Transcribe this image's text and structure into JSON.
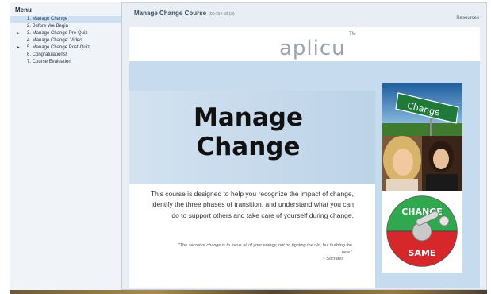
{
  "sidebar": {
    "title": "Menu",
    "items": [
      {
        "label": "1. Manage Change",
        "active": true,
        "expandable": false
      },
      {
        "label": "2. Before We Begin",
        "active": false,
        "expandable": false
      },
      {
        "label": "3. Manage Change Pre-Quiz",
        "active": false,
        "expandable": true
      },
      {
        "label": "4. Manage Change: Video",
        "active": false,
        "expandable": false
      },
      {
        "label": "5. Manage Change Post-Quiz",
        "active": false,
        "expandable": true
      },
      {
        "label": "6. Congratulations!",
        "active": false,
        "expandable": false
      },
      {
        "label": "7. Course Evaluation",
        "active": false,
        "expandable": false
      }
    ]
  },
  "header": {
    "course_title": "Manage Change Course",
    "time": "(00:19 / 18:18)",
    "resources_label": "Resources"
  },
  "slide": {
    "logo": "aplicu",
    "tm": "TM",
    "title_line1": "Manage",
    "title_line2": "Change",
    "description": "This course is designed to help you recognize the impact of change, identify the three phases of transition, and understand what you can do to support others and take care of yourself during change.",
    "quote": "\"The secret of change is to focus all of your energy, not on fighting the old, but building the new.\"",
    "quote_author": "~ Socrates",
    "sign_text": "Change",
    "switch_top": "CHANGE",
    "switch_bottom": "SAME"
  },
  "colors": {
    "sidebar_active": "#cfe1f2",
    "slide_background": "#c7dbee",
    "switch_green": "#2fa84f",
    "switch_red": "#d6272b"
  }
}
